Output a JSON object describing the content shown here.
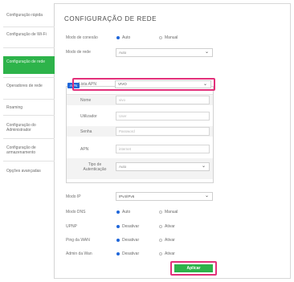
{
  "sidebar": {
    "items": [
      {
        "label": "Configuração rápida"
      },
      {
        "label": "Configuração de Wi-Fi"
      },
      {
        "label": "Configuração de rede"
      },
      {
        "label": "Operadores de rede"
      },
      {
        "label": "Roaming"
      },
      {
        "label": "Configuração do Administrador"
      },
      {
        "label": "Configuração de armazenamento"
      },
      {
        "label": "Opções avançadas"
      }
    ]
  },
  "main": {
    "title": "CONFIGURAÇÃO DE REDE",
    "connection_mode": {
      "label": "Modo de conexão",
      "option_auto": "Auto",
      "option_manual": "Manual"
    },
    "network_mode": {
      "label": "Modo de rede",
      "value": "Auto"
    },
    "apn": {
      "tag": "APN",
      "list": {
        "label": "Lista APN",
        "value": "VIVO"
      },
      "name": {
        "label": "Nome",
        "value": "vivo"
      },
      "user": {
        "label": "Utilizador",
        "value": "User"
      },
      "password": {
        "label": "Senha",
        "value": "Password"
      },
      "apn_field": {
        "label": "APN",
        "value": "internet"
      },
      "auth_type": {
        "label": "Tipo de Autenticação",
        "value": "Auto"
      }
    },
    "ip_mode": {
      "label": "Modo IP",
      "value": "IPv4/IPv6"
    },
    "dns_mode": {
      "label": "Modo DNS",
      "option_a": "Auto",
      "option_b": "Manual"
    },
    "upnp": {
      "label": "UPNP",
      "option_a": "Desativar",
      "option_b": "Ativar"
    },
    "ping_wan": {
      "label": "Ping da WAN",
      "option_a": "Desativar",
      "option_b": "Ativar"
    },
    "admin_wan": {
      "label": "Admin da Wan",
      "option_a": "Desativar",
      "option_b": "Ativar"
    },
    "apply_button": "Aplicar"
  },
  "colors": {
    "accent_green": "#2db34a",
    "highlight_pink": "#e3307a",
    "radio_blue": "#1f66d9"
  }
}
